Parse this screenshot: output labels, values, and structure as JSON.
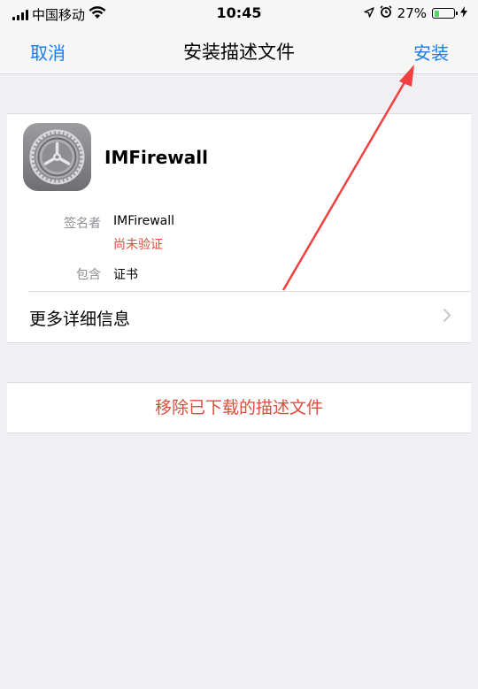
{
  "status_bar": {
    "carrier": "中国移动",
    "time": "10:45",
    "battery_percent": "27%",
    "battery_level": 0.27
  },
  "nav": {
    "cancel": "取消",
    "title": "安装描述文件",
    "install": "安装"
  },
  "profile": {
    "name": "IMFirewall",
    "icon": "settings-gear-icon",
    "signer_label": "签名者",
    "signer_value": "IMFirewall",
    "verification_status": "尚未验证",
    "contains_label": "包含",
    "contains_value": "证书",
    "more_details": "更多详细信息"
  },
  "remove": {
    "label": "移除已下载的描述文件"
  },
  "colors": {
    "accent": "#1a7cf3",
    "destructive": "#e04b3c",
    "annotation_arrow": "#f04040"
  }
}
